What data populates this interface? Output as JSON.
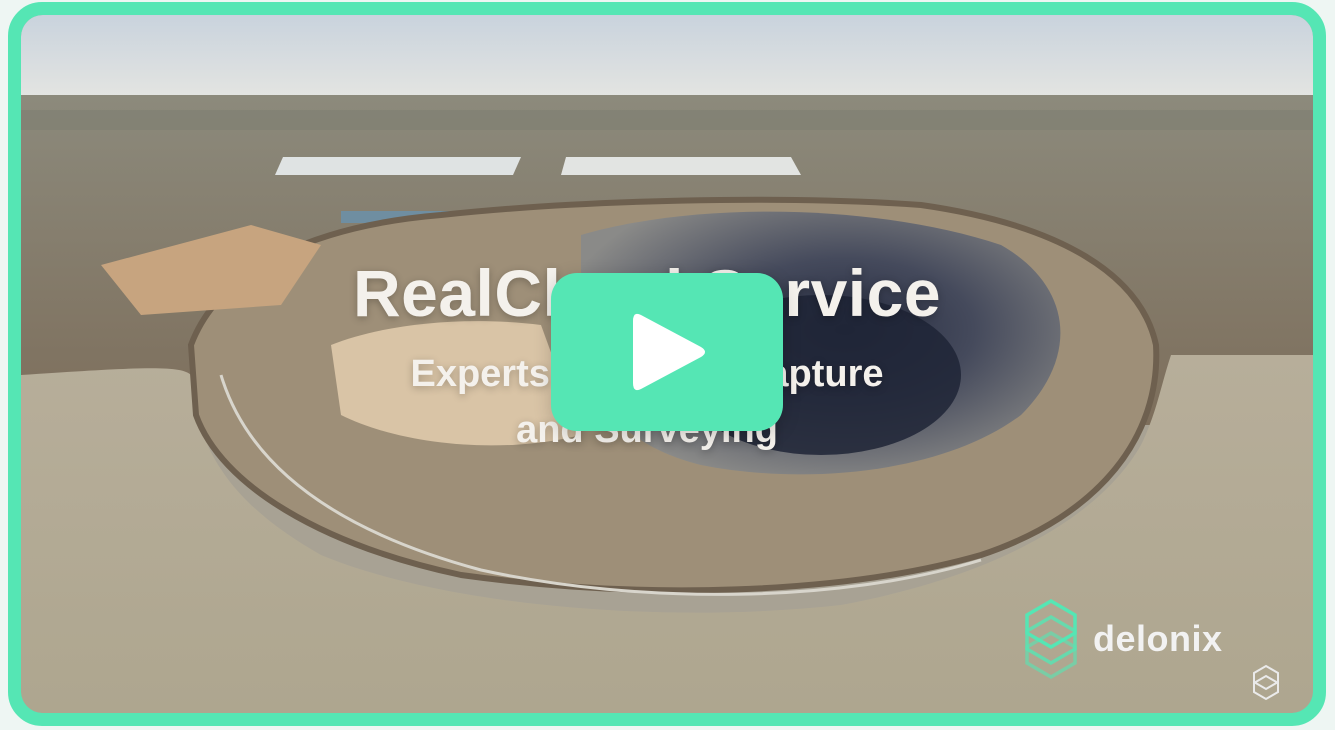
{
  "video": {
    "title": "RealCloud Service",
    "subtitle_line1": "Experts in Reality Capture",
    "subtitle_line2": "and Surveying",
    "play_label": "play-icon"
  },
  "brand": {
    "name": "delonix",
    "icon": "delonix-logo-icon"
  },
  "colors": {
    "accent": "#55e6b4",
    "water": "#b4ab97",
    "land": "#8b7f6b"
  }
}
